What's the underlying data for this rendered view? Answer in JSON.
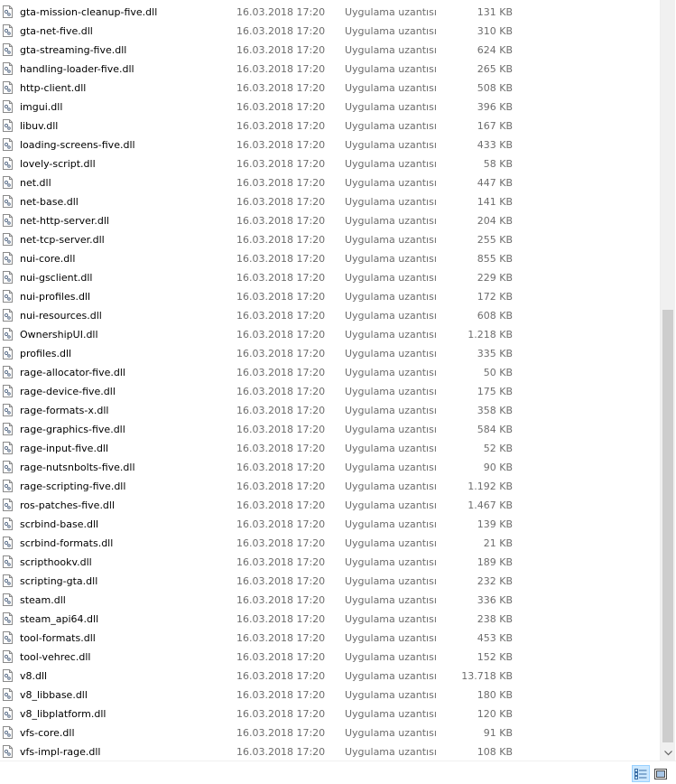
{
  "files": [
    {
      "name": "gta-mission-cleanup-five.dll",
      "date": "16.03.2018 17:20",
      "type": "Uygulama uzantısı",
      "size": "131 KB"
    },
    {
      "name": "gta-net-five.dll",
      "date": "16.03.2018 17:20",
      "type": "Uygulama uzantısı",
      "size": "310 KB"
    },
    {
      "name": "gta-streaming-five.dll",
      "date": "16.03.2018 17:20",
      "type": "Uygulama uzantısı",
      "size": "624 KB"
    },
    {
      "name": "handling-loader-five.dll",
      "date": "16.03.2018 17:20",
      "type": "Uygulama uzantısı",
      "size": "265 KB"
    },
    {
      "name": "http-client.dll",
      "date": "16.03.2018 17:20",
      "type": "Uygulama uzantısı",
      "size": "508 KB"
    },
    {
      "name": "imgui.dll",
      "date": "16.03.2018 17:20",
      "type": "Uygulama uzantısı",
      "size": "396 KB"
    },
    {
      "name": "libuv.dll",
      "date": "16.03.2018 17:20",
      "type": "Uygulama uzantısı",
      "size": "167 KB"
    },
    {
      "name": "loading-screens-five.dll",
      "date": "16.03.2018 17:20",
      "type": "Uygulama uzantısı",
      "size": "433 KB"
    },
    {
      "name": "lovely-script.dll",
      "date": "16.03.2018 17:20",
      "type": "Uygulama uzantısı",
      "size": "58 KB"
    },
    {
      "name": "net.dll",
      "date": "16.03.2018 17:20",
      "type": "Uygulama uzantısı",
      "size": "447 KB"
    },
    {
      "name": "net-base.dll",
      "date": "16.03.2018 17:20",
      "type": "Uygulama uzantısı",
      "size": "141 KB"
    },
    {
      "name": "net-http-server.dll",
      "date": "16.03.2018 17:20",
      "type": "Uygulama uzantısı",
      "size": "204 KB"
    },
    {
      "name": "net-tcp-server.dll",
      "date": "16.03.2018 17:20",
      "type": "Uygulama uzantısı",
      "size": "255 KB"
    },
    {
      "name": "nui-core.dll",
      "date": "16.03.2018 17:20",
      "type": "Uygulama uzantısı",
      "size": "855 KB"
    },
    {
      "name": "nui-gsclient.dll",
      "date": "16.03.2018 17:20",
      "type": "Uygulama uzantısı",
      "size": "229 KB"
    },
    {
      "name": "nui-profiles.dll",
      "date": "16.03.2018 17:20",
      "type": "Uygulama uzantısı",
      "size": "172 KB"
    },
    {
      "name": "nui-resources.dll",
      "date": "16.03.2018 17:20",
      "type": "Uygulama uzantısı",
      "size": "608 KB"
    },
    {
      "name": "OwnershipUI.dll",
      "date": "16.03.2018 17:20",
      "type": "Uygulama uzantısı",
      "size": "1.218 KB"
    },
    {
      "name": "profiles.dll",
      "date": "16.03.2018 17:20",
      "type": "Uygulama uzantısı",
      "size": "335 KB"
    },
    {
      "name": "rage-allocator-five.dll",
      "date": "16.03.2018 17:20",
      "type": "Uygulama uzantısı",
      "size": "50 KB"
    },
    {
      "name": "rage-device-five.dll",
      "date": "16.03.2018 17:20",
      "type": "Uygulama uzantısı",
      "size": "175 KB"
    },
    {
      "name": "rage-formats-x.dll",
      "date": "16.03.2018 17:20",
      "type": "Uygulama uzantısı",
      "size": "358 KB"
    },
    {
      "name": "rage-graphics-five.dll",
      "date": "16.03.2018 17:20",
      "type": "Uygulama uzantısı",
      "size": "584 KB"
    },
    {
      "name": "rage-input-five.dll",
      "date": "16.03.2018 17:20",
      "type": "Uygulama uzantısı",
      "size": "52 KB"
    },
    {
      "name": "rage-nutsnbolts-five.dll",
      "date": "16.03.2018 17:20",
      "type": "Uygulama uzantısı",
      "size": "90 KB"
    },
    {
      "name": "rage-scripting-five.dll",
      "date": "16.03.2018 17:20",
      "type": "Uygulama uzantısı",
      "size": "1.192 KB"
    },
    {
      "name": "ros-patches-five.dll",
      "date": "16.03.2018 17:20",
      "type": "Uygulama uzantısı",
      "size": "1.467 KB"
    },
    {
      "name": "scrbind-base.dll",
      "date": "16.03.2018 17:20",
      "type": "Uygulama uzantısı",
      "size": "139 KB"
    },
    {
      "name": "scrbind-formats.dll",
      "date": "16.03.2018 17:20",
      "type": "Uygulama uzantısı",
      "size": "21 KB"
    },
    {
      "name": "scripthookv.dll",
      "date": "16.03.2018 17:20",
      "type": "Uygulama uzantısı",
      "size": "189 KB"
    },
    {
      "name": "scripting-gta.dll",
      "date": "16.03.2018 17:20",
      "type": "Uygulama uzantısı",
      "size": "232 KB"
    },
    {
      "name": "steam.dll",
      "date": "16.03.2018 17:20",
      "type": "Uygulama uzantısı",
      "size": "336 KB"
    },
    {
      "name": "steam_api64.dll",
      "date": "16.03.2018 17:20",
      "type": "Uygulama uzantısı",
      "size": "238 KB"
    },
    {
      "name": "tool-formats.dll",
      "date": "16.03.2018 17:20",
      "type": "Uygulama uzantısı",
      "size": "453 KB"
    },
    {
      "name": "tool-vehrec.dll",
      "date": "16.03.2018 17:20",
      "type": "Uygulama uzantısı",
      "size": "152 KB"
    },
    {
      "name": "v8.dll",
      "date": "16.03.2018 17:20",
      "type": "Uygulama uzantısı",
      "size": "13.718 KB"
    },
    {
      "name": "v8_libbase.dll",
      "date": "16.03.2018 17:20",
      "type": "Uygulama uzantısı",
      "size": "180 KB"
    },
    {
      "name": "v8_libplatform.dll",
      "date": "16.03.2018 17:20",
      "type": "Uygulama uzantısı",
      "size": "120 KB"
    },
    {
      "name": "vfs-core.dll",
      "date": "16.03.2018 17:20",
      "type": "Uygulama uzantısı",
      "size": "91 KB"
    },
    {
      "name": "vfs-impl-rage.dll",
      "date": "16.03.2018 17:20",
      "type": "Uygulama uzantısı",
      "size": "108 KB"
    }
  ],
  "file_icon": "dll-file-icon",
  "colors": {
    "meta_text": "#6d6d6d",
    "selected_view_bg": "#cce8ff",
    "scroll_thumb": "#cdcdcd"
  },
  "status_bar": {
    "views": [
      {
        "icon": "details-view-icon",
        "selected": true
      },
      {
        "icon": "large-icons-view-icon",
        "selected": false
      }
    ]
  }
}
